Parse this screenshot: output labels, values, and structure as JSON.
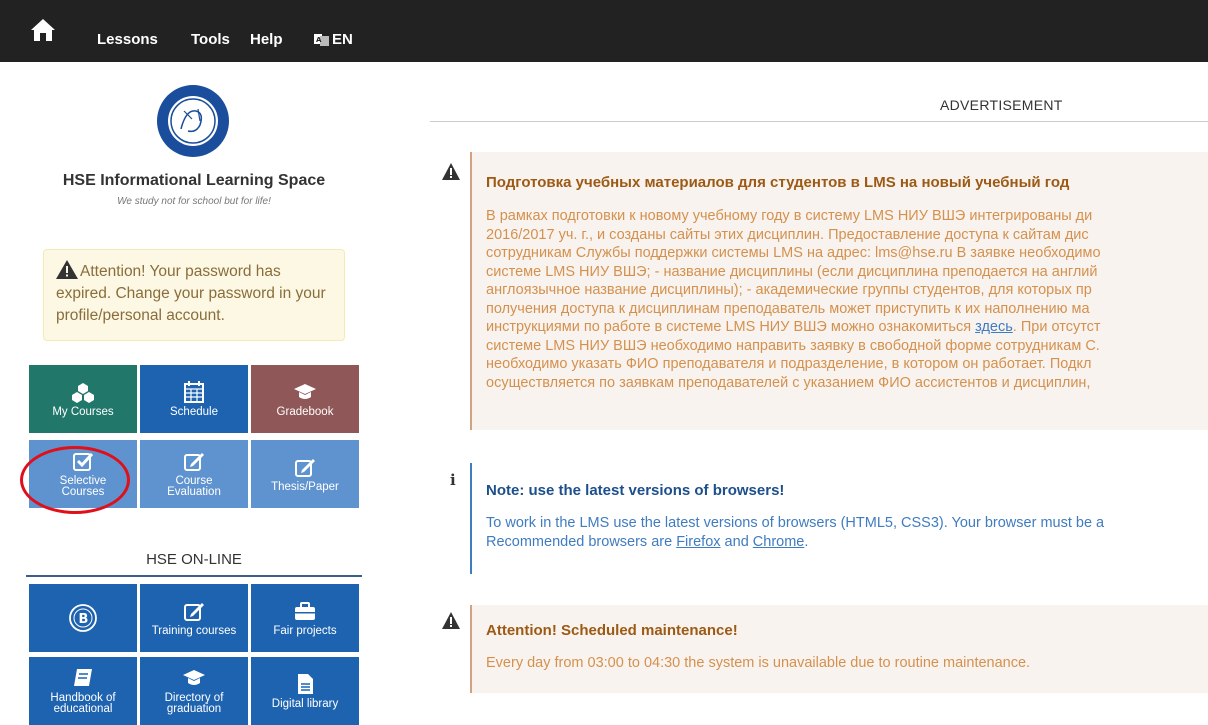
{
  "nav": {
    "lessons": "Lessons",
    "tools": "Tools",
    "help": "Help",
    "lang": "EN"
  },
  "site": {
    "title": "HSE Informational Learning Space",
    "tagline": "We study not for school but for life!"
  },
  "attention": {
    "text": "Attention! Your password has expired. Change your password in your profile/personal account."
  },
  "tiles": {
    "my_courses": "My Courses",
    "schedule": "Schedule",
    "gradebook": "Gradebook",
    "selective_1": "Selective",
    "selective_2": "Courses",
    "course_eval_1": "Course",
    "course_eval_2": "Evaluation",
    "thesis": "Thesis/Paper"
  },
  "online": {
    "title": "HSE ON-LINE",
    "training": "Training courses",
    "fair": "Fair projects",
    "handbook_1": "Handbook of",
    "handbook_2": "educational",
    "directory_1": "Directory of",
    "directory_2": "graduation",
    "library": "Digital library"
  },
  "advertisement": "ADVERTISEMENT",
  "news": {
    "item1": {
      "title": "Подготовка учебных материалов для студентов в LMS на новый учебный год",
      "lines": [
        "В рамках подготовки к новому учебному году в систему LMS НИУ ВШЭ интегрированы ди",
        "2016/2017 уч. г., и созданы сайты этих дисциплин. Предоставление доступа к сайтам дис",
        "сотрудникам Службы поддержки системы LMS на адрес: lms@hse.ru В заявке необходимо",
        "системе LMS НИУ ВШЭ; - название дисциплины (если дисциплина преподается на англий",
        "англоязычное название дисциплины); - академические группы студентов, для которых пр",
        "получения доступа к дисциплинам преподаватель может приступить к их наполнению ма"
      ],
      "line7_pre": "инструкциями по работе в системе LMS НИУ ВШЭ можно ознакомиться ",
      "line7_link": "здесь",
      "line7_post": ". При отсутст",
      "lines_tail": [
        "системе LMS НИУ ВШЭ необходимо направить заявку в свободной форме сотрудникам С.",
        "необходимо указать ФИО преподавателя и подразделение, в котором он работает. Подкл",
        "осуществляется по заявкам преподавателей с указанием ФИО ассистентов и дисциплин,"
      ]
    },
    "item2": {
      "title": "Note: use the latest versions of browsers!",
      "line1": "To work in the LMS use the latest versions of browsers (HTML5, CSS3). Your browser must be a",
      "line2_pre": "Recommended browsers are ",
      "firefox": "Firefox",
      "and": " and ",
      "chrome": "Chrome",
      "dot": "."
    },
    "item3": {
      "title": "Attention! Scheduled maintenance!",
      "body": "Every day from 03:00 to 04:30 the system is unavailable due to routine maintenance."
    }
  },
  "colors": {
    "navbar": "#222222",
    "warn_title": "#9c5a14",
    "warn_body": "#d4914e",
    "info_title": "#1d4f8c",
    "info_body": "#3f7cc0"
  }
}
